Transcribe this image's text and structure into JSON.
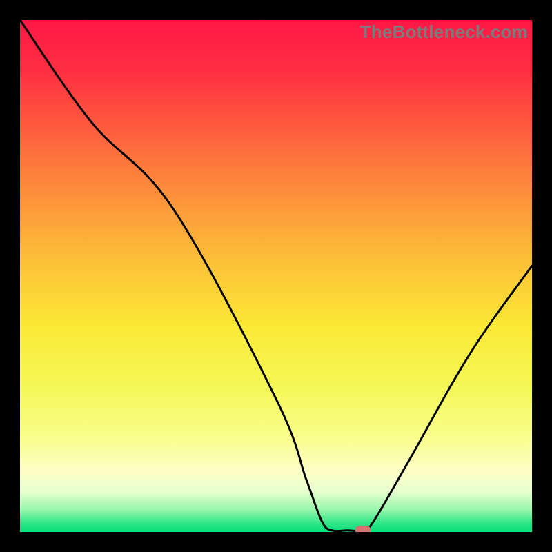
{
  "watermark": {
    "text": "TheBottleneck.com"
  },
  "chart_data": {
    "type": "line",
    "title": "",
    "xlabel": "",
    "ylabel": "",
    "xlim": [
      0,
      100
    ],
    "ylim": [
      0,
      100
    ],
    "curve": [
      {
        "x": 0,
        "y": 100
      },
      {
        "x": 14,
        "y": 80
      },
      {
        "x": 30,
        "y": 63
      },
      {
        "x": 50,
        "y": 26
      },
      {
        "x": 56,
        "y": 10
      },
      {
        "x": 59,
        "y": 2
      },
      {
        "x": 61,
        "y": 0.3
      },
      {
        "x": 64,
        "y": 0.3
      },
      {
        "x": 67,
        "y": 0.3
      },
      {
        "x": 69,
        "y": 2
      },
      {
        "x": 76,
        "y": 14
      },
      {
        "x": 88,
        "y": 35
      },
      {
        "x": 100,
        "y": 52
      }
    ],
    "marker": {
      "x": 67,
      "y": 0.3,
      "color": "#d4726f"
    },
    "gradient_stops": [
      {
        "offset": 0.0,
        "color": "#ff1846"
      },
      {
        "offset": 0.1,
        "color": "#ff2f42"
      },
      {
        "offset": 0.22,
        "color": "#fe5f3e"
      },
      {
        "offset": 0.35,
        "color": "#fd943b"
      },
      {
        "offset": 0.48,
        "color": "#fcc337"
      },
      {
        "offset": 0.6,
        "color": "#fbe936"
      },
      {
        "offset": 0.72,
        "color": "#f4f857"
      },
      {
        "offset": 0.82,
        "color": "#f9fe8f"
      },
      {
        "offset": 0.88,
        "color": "#fdffc5"
      },
      {
        "offset": 0.92,
        "color": "#e9ffd0"
      },
      {
        "offset": 0.955,
        "color": "#9cf7ac"
      },
      {
        "offset": 0.985,
        "color": "#29e585"
      },
      {
        "offset": 1.0,
        "color": "#0bdc7b"
      }
    ]
  }
}
